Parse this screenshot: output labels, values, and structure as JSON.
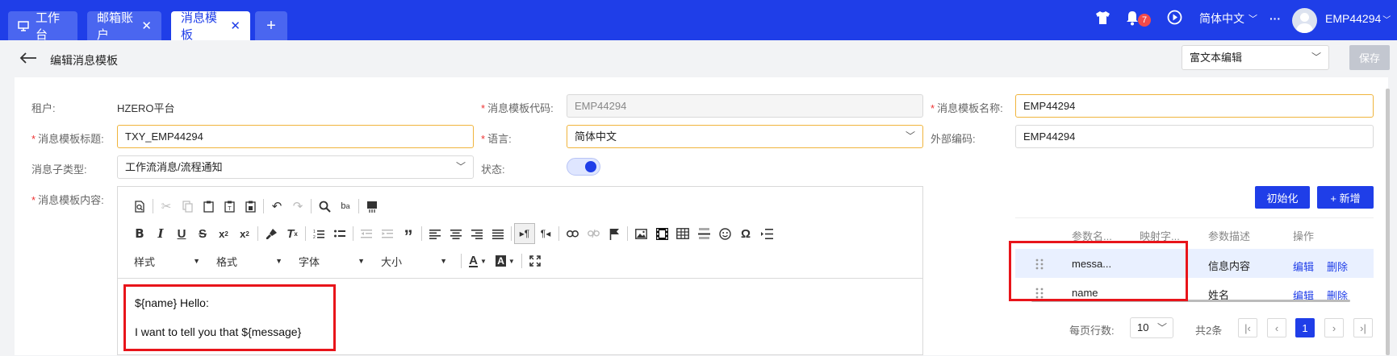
{
  "tabs": [
    {
      "label": "工作台",
      "icon": "monitor-icon",
      "closable": false,
      "active": false
    },
    {
      "label": "邮箱账户",
      "closable": true,
      "active": false
    },
    {
      "label": "消息模板",
      "closable": true,
      "active": true
    }
  ],
  "add_tab": "+",
  "header": {
    "notification_count": "7",
    "language": "简体中文",
    "more": "···",
    "username": "EMP44294"
  },
  "page": {
    "title": "编辑消息模板",
    "editor_mode": "富文本编辑",
    "save_label": "保存"
  },
  "form": {
    "tenant_label": "租户:",
    "tenant_value": "HZERO平台",
    "code_label": "消息模板代码:",
    "code_value": "EMP44294",
    "name_label": "消息模板名称:",
    "name_value": "EMP44294",
    "title_label": "消息模板标题:",
    "title_value": "TXY_EMP44294",
    "lang_label": "语言:",
    "lang_value": "简体中文",
    "extcode_label": "外部编码:",
    "extcode_value": "EMP44294",
    "subtype_label": "消息子类型:",
    "subtype_value": "工作流消息/流程通知",
    "status_label": "状态:",
    "content_label": "消息模板内容:"
  },
  "toolbar": {
    "style_dd": "样式",
    "format_dd": "格式",
    "font_dd": "字体",
    "size_dd": "大小"
  },
  "editor_content": {
    "line1": "${name} Hello:",
    "line2": "I want to tell you that ${message}"
  },
  "params": {
    "init_label": "初始化",
    "add_label": "+ 新增",
    "headers": [
      "参数名...",
      "映射字...",
      "参数描述",
      "操作"
    ],
    "rows": [
      {
        "name": "messa...",
        "desc": "信息内容",
        "edit": "编辑",
        "delete": "删除"
      },
      {
        "name": "name",
        "desc": "姓名",
        "edit": "编辑",
        "delete": "删除"
      }
    ]
  },
  "pagination": {
    "rows_label": "每页行数:",
    "page_size": "10",
    "total": "共2条",
    "current": "1"
  },
  "colors": {
    "brand": "#1f3ee8",
    "highlight": "#e8141a",
    "required": "#e33333"
  }
}
